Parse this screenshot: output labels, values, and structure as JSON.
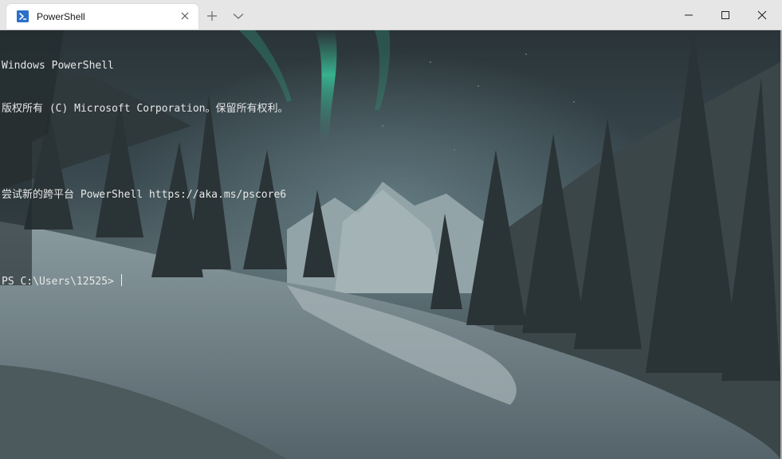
{
  "window": {
    "tab_title": "PowerShell",
    "tab_icon": "powershell-icon"
  },
  "terminal": {
    "lines": [
      "Windows PowerShell",
      "版权所有 (C) Microsoft Corporation。保留所有权利。",
      "",
      "尝试新的跨平台 PowerShell https://aka.ms/pscore6",
      "",
      "PS C:\\Users\\12525> "
    ],
    "background": "winter forest at night with aurora"
  },
  "colors": {
    "titlebar": "#e6e6e6",
    "tab_active": "#ffffff",
    "terminal_text": "#e8e8e8",
    "powershell_blue": "#2c6fc9"
  }
}
